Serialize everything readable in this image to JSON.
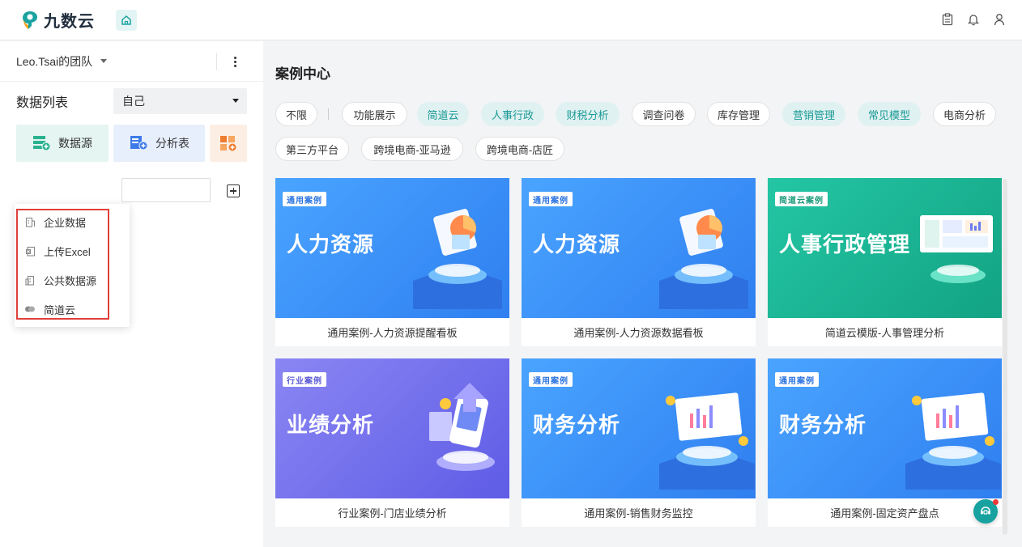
{
  "app": {
    "name": "九数云"
  },
  "sidebar": {
    "team_name": "Leo.Tsai的团队",
    "list_title": "数据列表",
    "owner_filter": "自己",
    "buttons": {
      "data_source": "数据源",
      "analysis_table": "分析表"
    },
    "dropdown": [
      "企业数据",
      "上传Excel",
      "公共数据源",
      "简道云"
    ]
  },
  "main": {
    "title": "案例中心",
    "tags": [
      {
        "label": "不限",
        "active": false
      },
      {
        "label": "功能展示",
        "active": false
      },
      {
        "label": "简道云",
        "active": true
      },
      {
        "label": "人事行政",
        "active": true
      },
      {
        "label": "财税分析",
        "active": true
      },
      {
        "label": "调查问卷",
        "active": false
      },
      {
        "label": "库存管理",
        "active": false
      },
      {
        "label": "营销管理",
        "active": true
      },
      {
        "label": "常见模型",
        "active": true
      },
      {
        "label": "电商分析",
        "active": false
      },
      {
        "label": "第三方平台",
        "active": false
      },
      {
        "label": "跨境电商-亚马逊",
        "active": false
      },
      {
        "label": "跨境电商-店匠",
        "active": false
      }
    ],
    "cards": [
      {
        "badge": "通用案例",
        "headline": "人力资源",
        "caption": "通用案例-人力资源提醒看板",
        "theme": "#2f8cf0"
      },
      {
        "badge": "通用案例",
        "headline": "人力资源",
        "caption": "通用案例-人力资源数据看板",
        "theme": "#2f8cf0"
      },
      {
        "badge": "简道云案例",
        "headline": "人事行政管理",
        "caption": "简道云模版-人事管理分析",
        "theme": "#16b592"
      },
      {
        "badge": "行业案例",
        "headline": "业绩分析",
        "caption": "行业案例-门店业绩分析",
        "theme": "#6b66e6"
      },
      {
        "badge": "通用案例",
        "headline": "财务分析",
        "caption": "通用案例-销售财务监控",
        "theme": "#2f8cf0"
      },
      {
        "badge": "通用案例",
        "headline": "财务分析",
        "caption": "通用案例-固定资产盘点",
        "theme": "#2f8cf0"
      }
    ]
  }
}
